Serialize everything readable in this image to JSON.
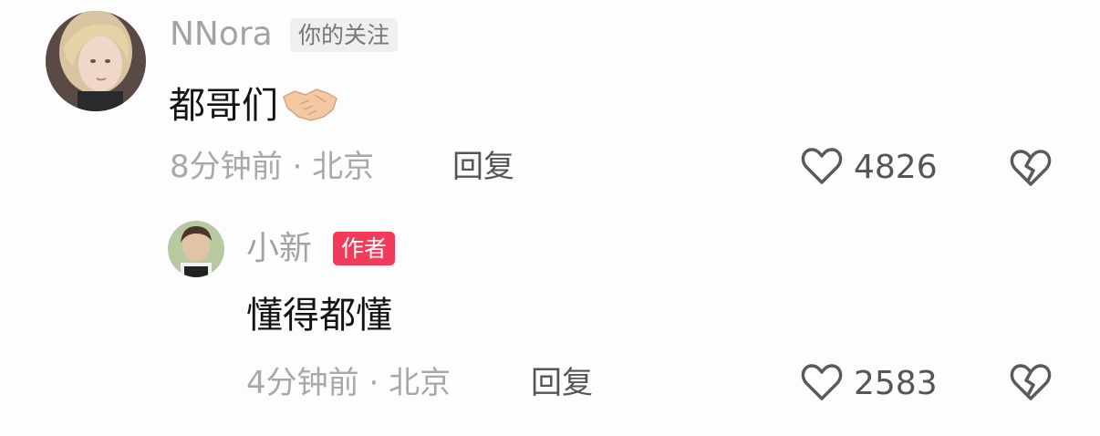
{
  "comments": [
    {
      "username": "NNora",
      "badge": "你的关注",
      "text": "都哥们",
      "emoji": "handshake-emoji",
      "time": "8分钟前",
      "separator": "·",
      "location": "北京",
      "reply_label": "回复",
      "likes": "4826",
      "avatar": "avatar-young-woman"
    },
    {
      "username": "小新",
      "badge": "作者",
      "text": "懂得都懂",
      "time": "4分钟前",
      "separator": "·",
      "location": "北京",
      "reply_label": "回复",
      "likes": "2583",
      "avatar": "avatar-young-man"
    }
  ],
  "colors": {
    "author_badge": "#f23a5a",
    "follow_badge_bg": "#efefef",
    "muted_text": "#a3a3a3"
  },
  "icons": {
    "like": "heart-outline-icon",
    "dislike": "broken-heart-icon"
  }
}
